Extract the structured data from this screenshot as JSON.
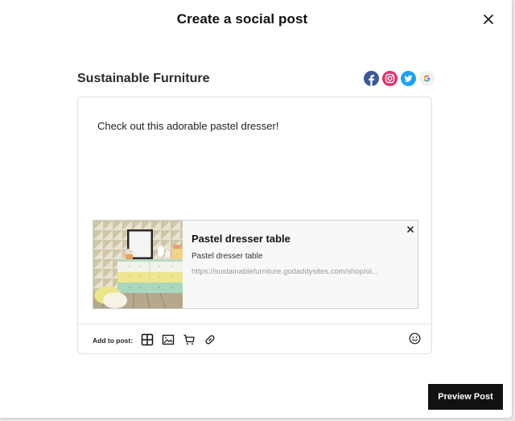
{
  "modal": {
    "title": "Create a social post",
    "close_icon": "close-icon"
  },
  "store": {
    "name": "Sustainable Furniture"
  },
  "social_channels": [
    {
      "name": "facebook",
      "icon": "facebook-icon",
      "color": "#3b5998"
    },
    {
      "name": "instagram",
      "icon": "instagram-icon",
      "color": "#e1306c"
    },
    {
      "name": "twitter",
      "icon": "twitter-icon",
      "color": "#1da1f2"
    },
    {
      "name": "google",
      "icon": "google-icon",
      "color": "#f1f1f1"
    }
  ],
  "composer": {
    "text": "Check out this adorable pastel dresser!",
    "link_preview": {
      "title": "Pastel dresser table",
      "description": "Pastel dresser table",
      "url": "https://sustainablefurniture.godaddysites.com/shop/ol...",
      "image": "pastel-dresser-photo"
    },
    "add_to_post_label": "Add to post:",
    "tools": [
      {
        "name": "layout",
        "icon": "layout-grid-icon"
      },
      {
        "name": "image",
        "icon": "image-icon"
      },
      {
        "name": "product",
        "icon": "cart-icon"
      },
      {
        "name": "link",
        "icon": "link-icon"
      }
    ],
    "emoji_icon": "emoji-icon"
  },
  "footer": {
    "preview_label": "Preview Post"
  }
}
